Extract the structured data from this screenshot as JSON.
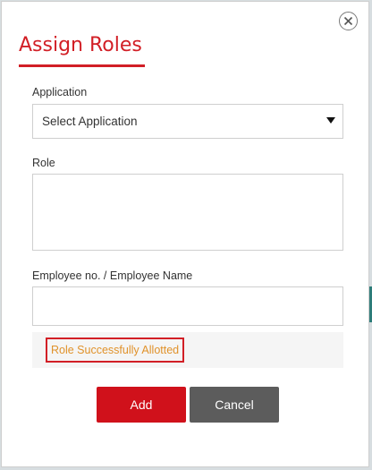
{
  "modal": {
    "title": "Assign Roles",
    "close_icon": "close-icon"
  },
  "application": {
    "label": "Application",
    "selected": "Select Application",
    "caret_icon": "caret-down-icon"
  },
  "role": {
    "label": "Role",
    "value": ""
  },
  "employee": {
    "label": "Employee no. / Employee Name",
    "value": ""
  },
  "status": {
    "message": "Role Successfully Allotted",
    "color": "#e0922a",
    "border_color": "#d21f26"
  },
  "actions": {
    "add_label": "Add",
    "cancel_label": "Cancel"
  },
  "colors": {
    "accent": "#d21f26",
    "add_button": "#d0111b",
    "cancel_button": "#5c5c5c"
  }
}
